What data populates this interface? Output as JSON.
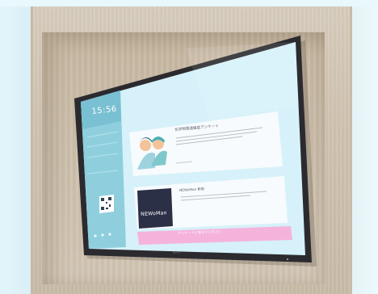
{
  "display": {
    "clock_time": "15:56",
    "brand": "BenQ"
  },
  "cards": [
    {
      "title": "化学物質過敏症アンケート",
      "illustration": "two-people-hugging-illustration"
    },
    {
      "title": "NEWoMan 新宿",
      "logo_text": "NEWoMan"
    }
  ],
  "banner": {
    "label": "アンケートに答えてください"
  },
  "sidebar": {
    "qr_icon": "qr-code-icon"
  },
  "colors": {
    "screen_blue": "#cfeef8",
    "sidebar_teal": "#7fc6d6",
    "banner_pink": "#f7b8df",
    "logo_navy": "#2c3047",
    "wood": "#cfc3b2",
    "bezel": "#2b2b2f"
  }
}
